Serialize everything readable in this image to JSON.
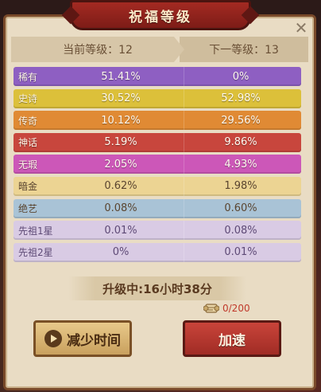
{
  "dialog": {
    "title": "祝福等级",
    "close_label": "✕"
  },
  "header": {
    "current_level": "当前等级：12",
    "next_level": "下一等级：13"
  },
  "rows": [
    {
      "name": "稀有",
      "current": "51.41%",
      "next": "0%",
      "color": "#8e5fc2",
      "style": ""
    },
    {
      "name": "史诗",
      "current": "30.52%",
      "next": "52.98%",
      "color": "#dcc03a",
      "style": ""
    },
    {
      "name": "传奇",
      "current": "10.12%",
      "next": "29.56%",
      "color": "#e08a34",
      "style": ""
    },
    {
      "name": "神话",
      "current": "5.19%",
      "next": "9.86%",
      "color": "#c8463d",
      "style": ""
    },
    {
      "name": "无瑕",
      "current": "2.05%",
      "next": "4.93%",
      "color": "#cc57b8",
      "style": ""
    },
    {
      "name": "暗金",
      "current": "0.62%",
      "next": "1.98%",
      "color": "#ecd493",
      "style": "light"
    },
    {
      "name": "绝艺",
      "current": "0.08%",
      "next": "0.60%",
      "color": "#a9c3d6",
      "style": "light"
    },
    {
      "name": "先祖1星",
      "current": "0.01%",
      "next": "0.08%",
      "color": "#d9cbe4",
      "style": "lavender"
    },
    {
      "name": "先祖2星",
      "current": "0%",
      "next": "0.01%",
      "color": "#d9cbe4",
      "style": "lavender"
    }
  ],
  "upgrade": {
    "timer_text": "升级中:16小时38分",
    "progress_text": "0/200"
  },
  "buttons": {
    "reduce_time": "减少时间",
    "speed_up": "加速"
  }
}
